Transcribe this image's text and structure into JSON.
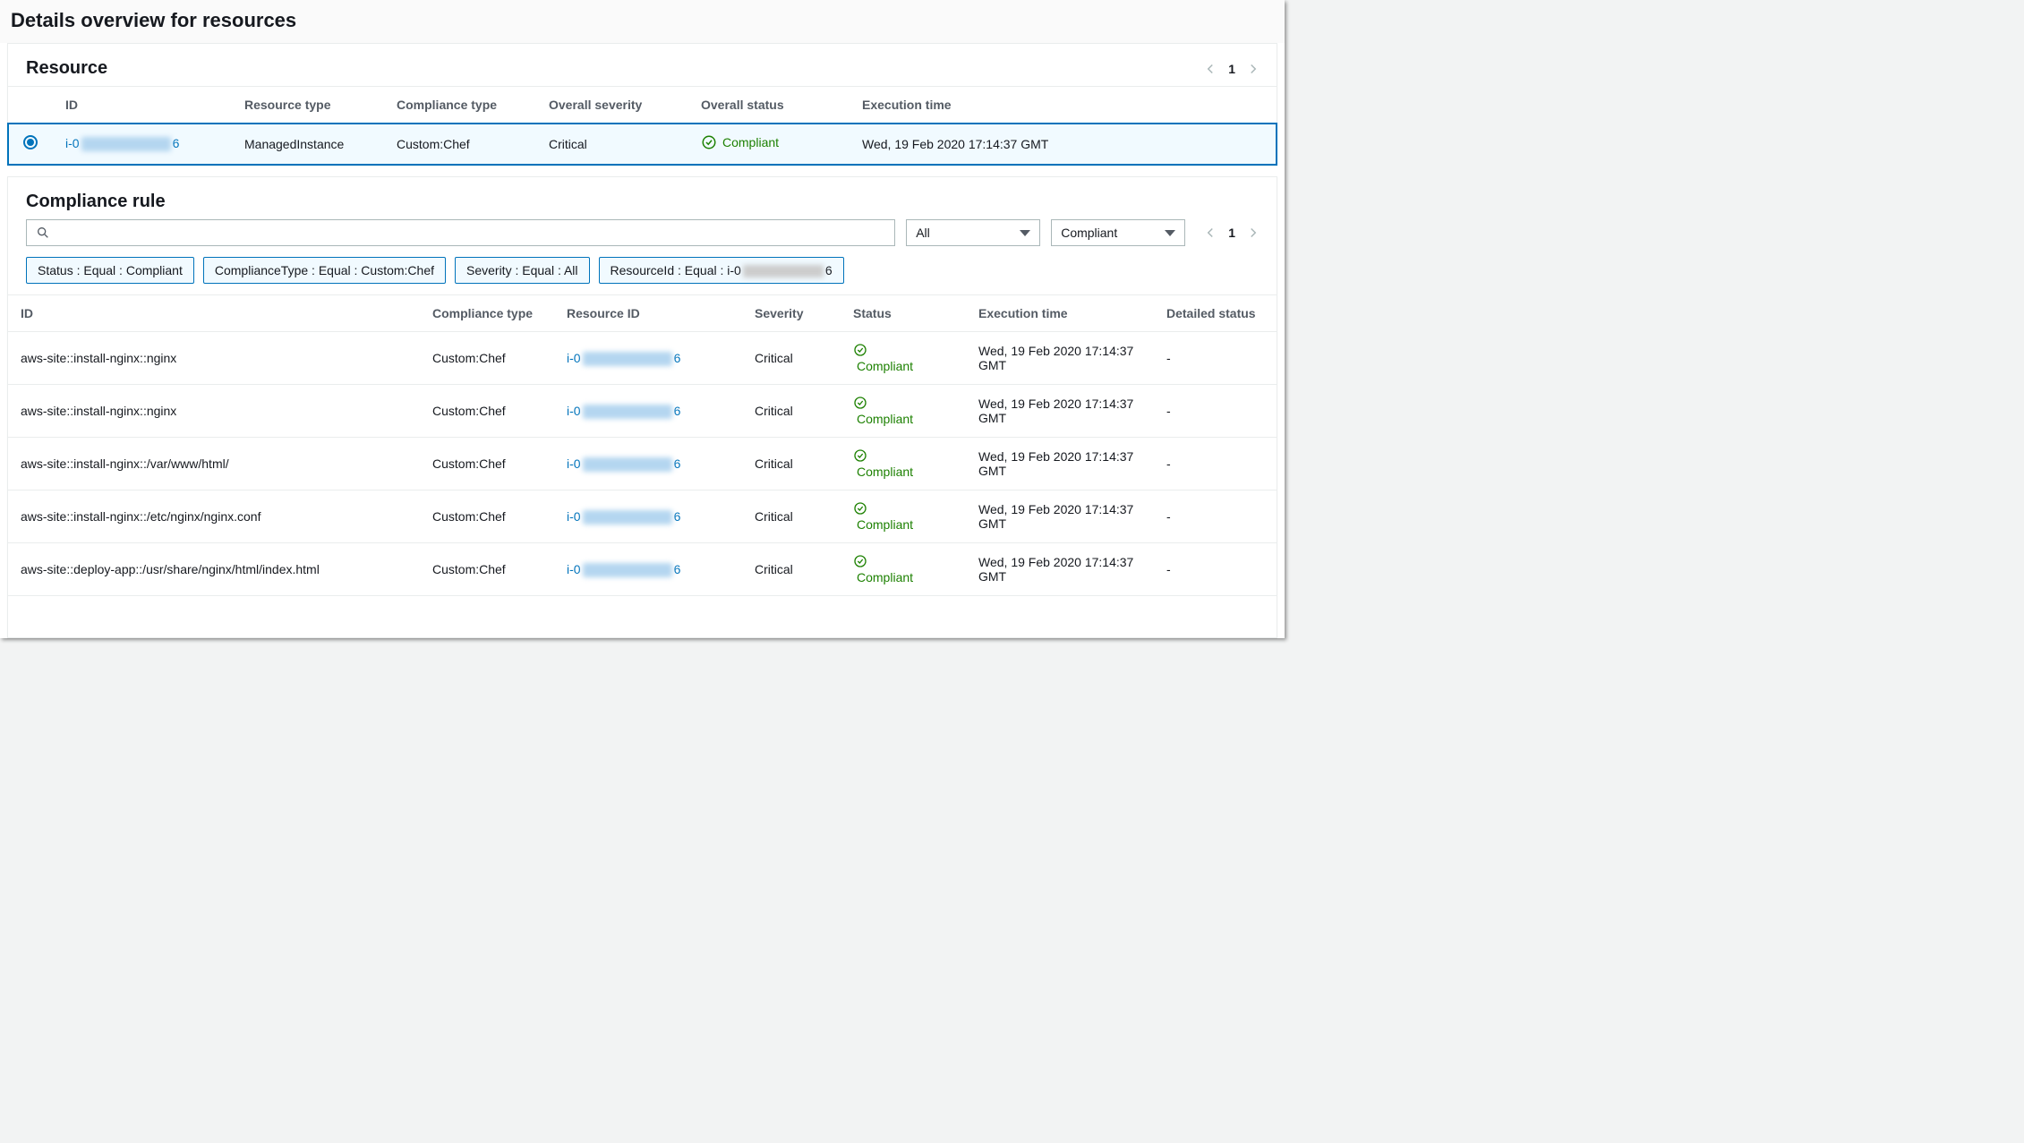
{
  "page_title": "Details overview for resources",
  "resource_panel": {
    "title": "Resource",
    "page": "1",
    "columns": [
      "ID",
      "Resource type",
      "Compliance type",
      "Overall severity",
      "Overall status",
      "Execution time"
    ],
    "row": {
      "id_prefix": "i-0",
      "id_suffix": "6",
      "resource_type": "ManagedInstance",
      "compliance_type": "Custom:Chef",
      "severity": "Critical",
      "status": "Compliant",
      "execution_time": "Wed, 19 Feb 2020 17:14:37 GMT"
    }
  },
  "rule_panel": {
    "title": "Compliance rule",
    "select_severity": "All",
    "select_status": "Compliant",
    "page": "1",
    "filters": {
      "status": "Status : Equal : Compliant",
      "compliance_type": "ComplianceType : Equal : Custom:Chef",
      "severity": "Severity : Equal : All",
      "resource_prefix": "ResourceId : Equal : i-0",
      "resource_suffix": "6"
    },
    "columns": [
      "ID",
      "Compliance type",
      "Resource ID",
      "Severity",
      "Status",
      "Execution time",
      "Detailed status"
    ],
    "rows": [
      {
        "id": "aws-site::install-nginx::nginx",
        "compliance_type": "Custom:Chef",
        "rid_prefix": "i-0",
        "rid_suffix": "6",
        "severity": "Critical",
        "status": "Compliant",
        "execution_time": "Wed, 19 Feb 2020 17:14:37 GMT",
        "detailed": "-"
      },
      {
        "id": "aws-site::install-nginx::nginx",
        "compliance_type": "Custom:Chef",
        "rid_prefix": "i-0",
        "rid_suffix": "6",
        "severity": "Critical",
        "status": "Compliant",
        "execution_time": "Wed, 19 Feb 2020 17:14:37 GMT",
        "detailed": "-"
      },
      {
        "id": "aws-site::install-nginx::/var/www/html/",
        "compliance_type": "Custom:Chef",
        "rid_prefix": "i-0",
        "rid_suffix": "6",
        "severity": "Critical",
        "status": "Compliant",
        "execution_time": "Wed, 19 Feb 2020 17:14:37 GMT",
        "detailed": "-"
      },
      {
        "id": "aws-site::install-nginx::/etc/nginx/nginx.conf",
        "compliance_type": "Custom:Chef",
        "rid_prefix": "i-0",
        "rid_suffix": "6",
        "severity": "Critical",
        "status": "Compliant",
        "execution_time": "Wed, 19 Feb 2020 17:14:37 GMT",
        "detailed": "-"
      },
      {
        "id": "aws-site::deploy-app::/usr/share/nginx/html/index.html",
        "compliance_type": "Custom:Chef",
        "rid_prefix": "i-0",
        "rid_suffix": "6",
        "severity": "Critical",
        "status": "Compliant",
        "execution_time": "Wed, 19 Feb 2020 17:14:37 GMT",
        "detailed": "-"
      }
    ]
  }
}
